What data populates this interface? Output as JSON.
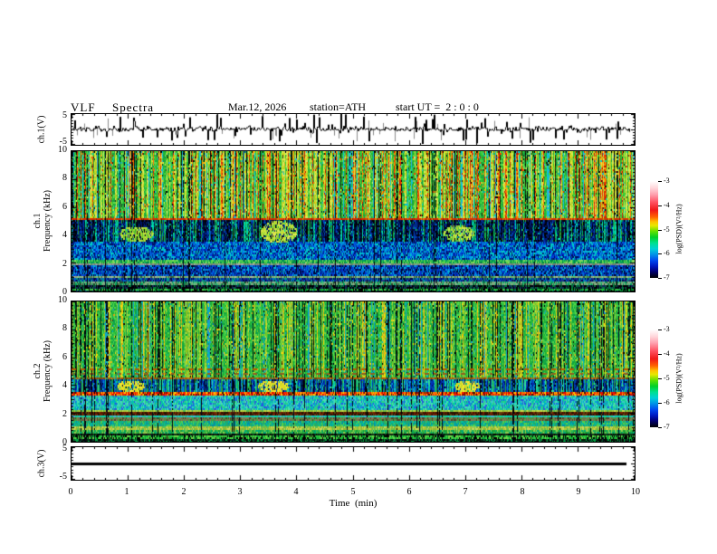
{
  "header": {
    "title": "VLF  Spectra",
    "date": "Mar.12, 2026",
    "station": "station=ATH",
    "start_ut": "start UT =  2 : 0 : 0"
  },
  "time_axis": {
    "label": "Time  (min)",
    "ticks": [
      "0",
      "1",
      "2",
      "3",
      "4",
      "5",
      "6",
      "7",
      "8",
      "9",
      "10"
    ],
    "range_min": [
      0,
      10
    ],
    "minor_step_min": 0.2
  },
  "panels": {
    "ch1_wave": {
      "ylabel": "ch.1(V)",
      "ytick_top": "5",
      "ytick_bottom": "-5",
      "ylim": [
        -5,
        5
      ]
    },
    "ch1_spec": {
      "ylabel_ch": "ch.1",
      "ylabel_axis": "Frequency  (kHz)",
      "yticks": [
        "10",
        "8",
        "6",
        "4",
        "2",
        "0"
      ],
      "ylim": [
        0,
        10
      ]
    },
    "ch2_spec": {
      "ylabel_ch": "ch.2",
      "ylabel_axis": "Frequency  (kHz)",
      "yticks": [
        "10",
        "8",
        "6",
        "4",
        "2",
        "0"
      ],
      "ylim": [
        0,
        10
      ]
    },
    "ch3_wave": {
      "ylabel": "ch.3(V)",
      "ytick_top": "5",
      "ytick_bottom": "-5",
      "ylim": [
        -5,
        5
      ]
    }
  },
  "colorbar": {
    "label": "log(PSD)(V²/Hz)",
    "ticks": [
      "-3",
      "-4",
      "-5",
      "-6",
      "-7"
    ],
    "range": [
      -3,
      -7
    ],
    "gradient": [
      [
        "#ffffff",
        0
      ],
      [
        "#ffd8dc",
        7
      ],
      [
        "#ff9fae",
        14
      ],
      [
        "#ff5060",
        22
      ],
      [
        "#f01818",
        30
      ],
      [
        "#ff6000",
        37
      ],
      [
        "#ffc000",
        42
      ],
      [
        "#e8e800",
        46
      ],
      [
        "#60e000",
        52
      ],
      [
        "#00d028",
        58
      ],
      [
        "#00e090",
        64
      ],
      [
        "#00d0d8",
        70
      ],
      [
        "#0090e8",
        76
      ],
      [
        "#0048f0",
        82
      ],
      [
        "#0018c0",
        88
      ],
      [
        "#000078",
        93
      ],
      [
        "#000000",
        100
      ]
    ]
  },
  "noise_seed": 20260312,
  "chart_data": [
    {
      "type": "line",
      "name": "ch1-waveform",
      "ylabel": "ch.1(V)",
      "ylim": [
        -5,
        5
      ],
      "x_range_min": [
        0,
        10
      ],
      "baseline_v": 0,
      "noise_sigma_v": 0.45,
      "spike_probability": 0.12,
      "spike_amp_v": [
        1,
        4.8
      ],
      "description": "broadband noise trace centered on 0 V with frequent impulsive spikes up to ±5 V"
    },
    {
      "type": "heatmap",
      "name": "ch1-spectrogram",
      "xlabel": "Time  (min)",
      "xlim": [
        0,
        10
      ],
      "ylabel": "ch.1 Frequency (kHz)",
      "ylim": [
        0,
        10
      ],
      "zlabel": "log(PSD)(V²/Hz)",
      "zlim": [
        -7,
        -3
      ],
      "streaks": {
        "dark_p": 0.045,
        "warm_p": 0
      },
      "bands": [
        {
          "f": [
            0,
            0.18
          ],
          "colors": [
            "#000000",
            "#000000",
            "#003018",
            "#00a040",
            "#004080"
          ]
        },
        {
          "f": [
            0.18,
            0.32
          ],
          "colors": [
            "#20b840",
            "#50d050",
            "#008830",
            "#000000"
          ]
        },
        {
          "f": [
            0.32,
            0.52
          ],
          "colors": [
            "#000010",
            "#000000",
            "#102858",
            "#007838"
          ]
        },
        {
          "f": [
            0.52,
            0.78
          ],
          "colors": [
            "#78a878",
            "#8fb08f",
            "#44bb77",
            "#2a4a2a",
            "#00a060"
          ]
        },
        {
          "f": [
            0.78,
            0.98
          ],
          "colors": [
            "#0020a0",
            "#000048",
            "#0060c8",
            "#00a088",
            "#203878"
          ]
        },
        {
          "f": [
            0.98,
            1.18
          ],
          "colors": [
            "#88a878",
            "#a8b898",
            "#60c060",
            "#3a5a3a"
          ]
        },
        {
          "f": [
            1.18,
            1.92
          ],
          "colors": [
            "#0030d0",
            "#001878",
            "#0068e0",
            "#00b0d8",
            "#000030",
            "#0048b0"
          ]
        },
        {
          "f": [
            1.92,
            2.06
          ],
          "colors": [
            "#909090",
            "#787878",
            "#58a058",
            "#a8a8a8"
          ]
        },
        {
          "f": [
            2.06,
            2.32
          ],
          "colors": [
            "#30c050",
            "#58d848",
            "#00a058",
            "#88d860",
            "#008840"
          ]
        },
        {
          "f": [
            2.32,
            3.56
          ],
          "colors": [
            "#0040e0",
            "#0028a0",
            "#00a0e8",
            "#00d0c0",
            "#001060",
            "#0070d0"
          ]
        },
        {
          "f": [
            3.56,
            5.14
          ],
          "columnar": true,
          "palettes": [
            [
              "#000428",
              "#001060",
              "#000000",
              "#002080"
            ],
            [
              "#0030a0",
              "#0050c0",
              "#001048"
            ],
            [
              "#00c0a0",
              "#00e0b0",
              "#008858"
            ],
            [
              "#30a830",
              "#00b868",
              "#107038"
            ],
            [
              "#000000",
              "#000818"
            ]
          ],
          "weights": [
            0.34,
            0.22,
            0.18,
            0.16,
            0.1
          ]
        },
        {
          "f": [
            5.14,
            5.3
          ],
          "colors": [
            "#e03800",
            "#c04800",
            "#ff6810",
            "#a01000",
            "#d0a000"
          ]
        },
        {
          "f": [
            5.3,
            10.01
          ],
          "columnar": true,
          "palettes": [
            [
              "#38cc38",
              "#20b830",
              "#60d850",
              "#18a040"
            ],
            [
              "#ccd820",
              "#e0e838",
              "#a8cc28",
              "#d8e868"
            ],
            [
              "#ff7000",
              "#e83000",
              "#ffa800",
              "#c01800"
            ],
            [
              "#000000",
              "#201800",
              "#084018"
            ],
            [
              "#00c8d0",
              "#30b0e0"
            ]
          ],
          "weights": [
            0.4,
            0.3,
            0.15,
            0.08,
            0.07
          ]
        }
      ],
      "h_lines": [
        {
          "f": 5.22,
          "color": "#d83000",
          "dashed": true
        }
      ],
      "blobs": [
        {
          "t": [
            0.85,
            1.45
          ],
          "f": [
            3.6,
            4.7
          ],
          "colors": [
            "#a8d830",
            "#c8e040",
            "#60c830"
          ]
        },
        {
          "t": [
            3.35,
            4.0
          ],
          "f": [
            3.5,
            5.1
          ],
          "colors": [
            "#c8e030",
            "#e0e850",
            "#88d030"
          ]
        },
        {
          "t": [
            6.6,
            7.15
          ],
          "f": [
            3.6,
            4.8
          ],
          "colors": [
            "#a8d830",
            "#d0e848",
            "#58c040"
          ]
        }
      ]
    },
    {
      "type": "heatmap",
      "name": "ch2-spectrogram",
      "xlabel": "Time  (min)",
      "xlim": [
        0,
        10
      ],
      "ylabel": "ch.2 Frequency (kHz)",
      "ylim": [
        0,
        10
      ],
      "zlabel": "log(PSD)(V²/Hz)",
      "zlim": [
        -7,
        -3
      ],
      "streaks": {
        "dark_p": 0.075,
        "warm_p": 0
      },
      "bands": [
        {
          "f": [
            0,
            0.22
          ],
          "colors": [
            "#000000",
            "#001808",
            "#00a040",
            "#084828"
          ]
        },
        {
          "f": [
            0.22,
            0.48
          ],
          "colors": [
            "#28c840",
            "#08a830",
            "#70d848",
            "#000000"
          ]
        },
        {
          "f": [
            0.48,
            0.62
          ],
          "colors": [
            "#000000",
            "#102010",
            "#084018"
          ]
        },
        {
          "f": [
            0.62,
            0.92
          ],
          "colors": [
            "#38bb44",
            "#18a038",
            "#90cc50",
            "#00a878"
          ]
        },
        {
          "f": [
            0.92,
            1.14
          ],
          "colors": [
            "#b8c838",
            "#98b830",
            "#60c050",
            "#d0d858"
          ]
        },
        {
          "f": [
            1.14,
            1.6
          ],
          "colors": [
            "#28b060",
            "#00c0a0",
            "#58d048",
            "#0090a8",
            "#18a878"
          ]
        },
        {
          "f": [
            1.6,
            1.78
          ],
          "colors": [
            "#687848",
            "#887858",
            "#40a040",
            "#504828"
          ]
        },
        {
          "f": [
            1.78,
            1.96
          ],
          "colors": [
            "#00c8c0",
            "#00e0a8",
            "#40b8e0",
            "#28cc88"
          ]
        },
        {
          "f": [
            1.96,
            2.14
          ],
          "colors": [
            "#581800",
            "#380c00",
            "#782000",
            "#201000",
            "#604010"
          ]
        },
        {
          "f": [
            2.14,
            2.3
          ],
          "colors": [
            "#b0c838",
            "#90c030",
            "#c8d848",
            "#58b848"
          ]
        },
        {
          "f": [
            2.3,
            3.38
          ],
          "colors": [
            "#28d088",
            "#00cca0",
            "#48e0b0",
            "#00a8d0",
            "#2858e0",
            "#38c8c8"
          ]
        },
        {
          "f": [
            3.38,
            3.58
          ],
          "colors": [
            "#ff2000",
            "#e00800",
            "#ff7000",
            "#ffc800",
            "#481000"
          ]
        },
        {
          "f": [
            3.58,
            4.48
          ],
          "columnar": true,
          "palettes": [
            [
              "#0030c0",
              "#001870",
              "#0048a8"
            ],
            [
              "#0068d8",
              "#0098d0",
              "#0028a0"
            ],
            [
              "#00c8b0",
              "#30dd99"
            ],
            [
              "#28a838",
              "#109858"
            ],
            [
              "#000020",
              "#000000"
            ]
          ],
          "weights": [
            0.3,
            0.22,
            0.2,
            0.18,
            0.1
          ]
        },
        {
          "f": [
            4.48,
            4.66
          ],
          "colors": [
            "#b85800",
            "#985010",
            "#784800",
            "#30a060",
            "#c87818"
          ]
        },
        {
          "f": [
            4.66,
            10.01
          ],
          "columnar": true,
          "palettes": [
            [
              "#30c440",
              "#1cb034",
              "#54d44c",
              "#0ca04c"
            ],
            [
              "#98cc30",
              "#c0d838",
              "#78c428"
            ],
            [
              "#e8d820",
              "#ffd800",
              "#e0a810"
            ],
            [
              "#000000",
              "#102808",
              "#083820"
            ],
            [
              "#00b8c0",
              "#2090d0"
            ]
          ],
          "weights": [
            0.52,
            0.2,
            0.08,
            0.12,
            0.08
          ]
        }
      ],
      "h_lines": [
        {
          "f": 5.2,
          "color": "#b85800",
          "dashed": true
        },
        {
          "f": 4.9,
          "color": "#906020",
          "dashed": true
        }
      ],
      "blobs": [
        {
          "t": [
            0.8,
            1.3
          ],
          "f": [
            3.6,
            4.45
          ],
          "colors": [
            "#e8e020",
            "#ffe830",
            "#c8d828"
          ]
        },
        {
          "t": [
            3.3,
            3.85
          ],
          "f": [
            3.6,
            4.45
          ],
          "colors": [
            "#e8e020",
            "#ffe830",
            "#d0d828"
          ]
        },
        {
          "t": [
            6.8,
            7.25
          ],
          "f": [
            3.6,
            4.45
          ],
          "colors": [
            "#e8e020",
            "#f0e838",
            "#c8d828"
          ]
        }
      ]
    },
    {
      "type": "line",
      "name": "ch3-waveform",
      "ylabel": "ch.3(V)",
      "ylim": [
        -5,
        5
      ],
      "x_range_min": [
        0,
        10
      ],
      "constant_v": 0,
      "line_end_min": 9.85,
      "line_thickness_px": 3,
      "description": "flat signal at 0 V for entire interval"
    }
  ]
}
